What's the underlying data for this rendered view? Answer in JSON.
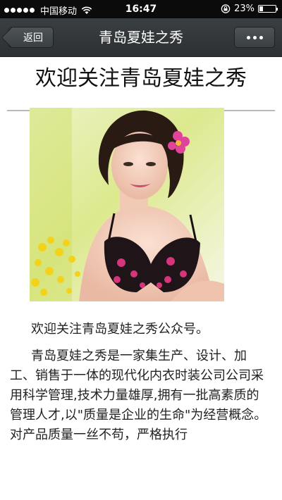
{
  "status_bar": {
    "carrier": "中国移动",
    "time": "16:47",
    "battery": "23%",
    "battery_level": 0.23,
    "signal_dots": 5
  },
  "nav": {
    "back_label": "返回",
    "title": "青岛夏娃之秀",
    "icons": {
      "more": "more-dots-icon"
    }
  },
  "article": {
    "heading": "欢迎关注青岛夏娃之秀",
    "image_icon": "lingerie-model-photo",
    "paragraphs": [
      "欢迎关注青岛夏娃之秀公众号。",
      "青岛夏娃之秀是一家集生产、设计、加工、销售于一体的现代化内衣时装公司公司采用科学管理,技术力量雄厚,拥有一批高素质的管理人才,以\"质量是企业的生命\"为经营概念。对产品质量一丝不苟，严格执行"
    ]
  },
  "colors": {
    "status_bar_bg": "#0b0b0b",
    "nav_bg": "#33383b",
    "text": "#222222"
  }
}
